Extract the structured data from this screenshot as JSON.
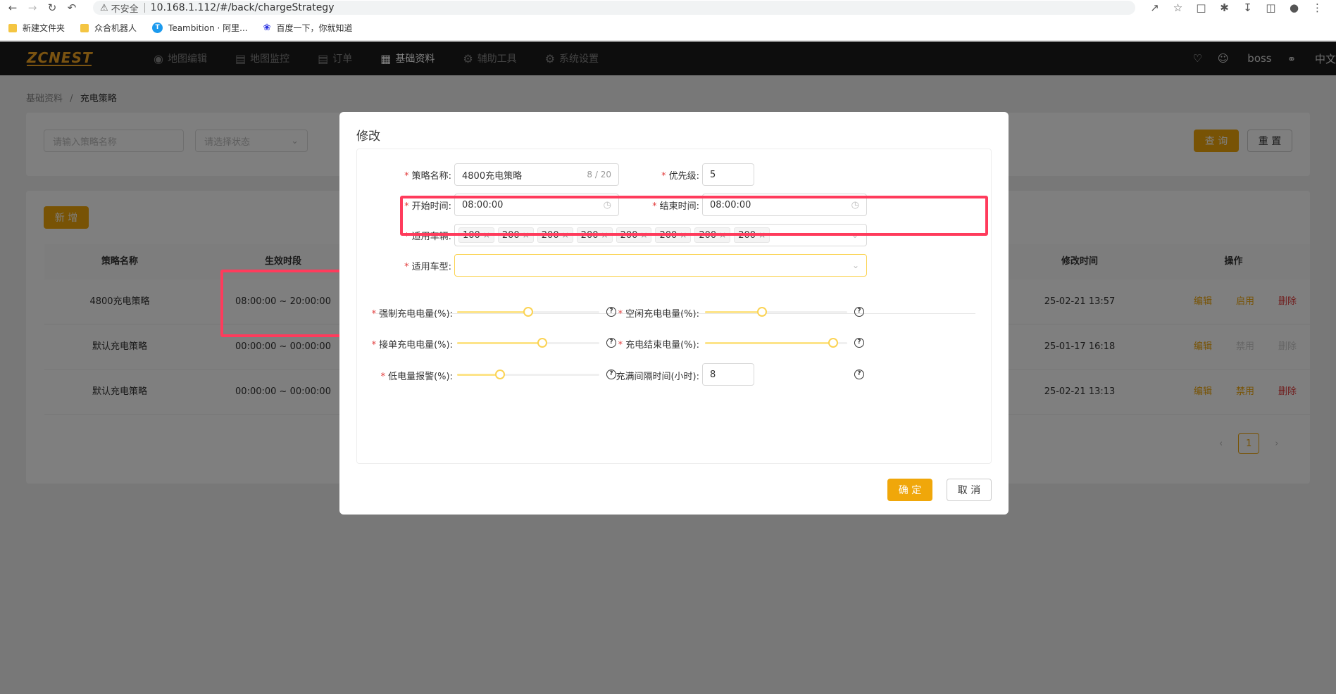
{
  "browser": {
    "insecure_label": "不安全",
    "url": "10.168.1.112/#/back/chargeStrategy",
    "bookmarks": [
      "新建文件夹",
      "众合机器人",
      "Teambition · 阿里...",
      "百度一下，你就知道"
    ]
  },
  "header": {
    "logo": "ZCNEST",
    "menu": [
      "地图编辑",
      "地图监控",
      "订单",
      "基础资料",
      "辅助工具",
      "系统设置"
    ],
    "active_menu": "基础资料",
    "user": "boss",
    "lang": "中文"
  },
  "breadcrumb": {
    "parent": "基础资料",
    "sep": "/",
    "current": "充电策略"
  },
  "search": {
    "name_placeholder": "请输入策略名称",
    "status_placeholder": "请选择状态",
    "query_label": "查 询",
    "reset_label": "重 置"
  },
  "table": {
    "add_label": "新 增",
    "columns": [
      "策略名称",
      "生效时段",
      "修改时间",
      "操作"
    ],
    "rows": [
      {
        "name": "4800充电策略",
        "period": "08:00:00 ~ 20:00:00",
        "modified": "25-02-21 13:57",
        "edit": "编辑",
        "toggle": "启用",
        "delete": "删除"
      },
      {
        "name": "默认充电策略",
        "period": "00:00:00 ~ 00:00:00",
        "modified": "25-01-17 16:18",
        "edit": "编辑",
        "toggle": "禁用",
        "delete": "删除"
      },
      {
        "name": "默认充电策略",
        "period": "00:00:00 ~ 00:00:00",
        "modified": "25-02-21 13:13",
        "edit": "编辑",
        "toggle": "禁用",
        "delete": "删除"
      }
    ],
    "pagination": {
      "current": "1"
    }
  },
  "dialog": {
    "title": "修改",
    "fields": {
      "name_label": "策略名称:",
      "name_value": "4800充电策略",
      "name_count": "8 / 20",
      "priority_label": "优先级:",
      "priority_value": "5",
      "start_label": "开始时间:",
      "start_value": "08:00:00",
      "end_label": "结束时间:",
      "end_value": "08:00:00",
      "vehicles_label": "适用车辆:",
      "vehicle_tags": [
        "100",
        "200",
        "200",
        "200",
        "200",
        "200",
        "200",
        "200"
      ],
      "vtype_label": "适用车型:",
      "force_label": "强制充电电量(%):",
      "idle_label": "空闲充电电量(%):",
      "order_label": "接单充电电量(%):",
      "end_charge_label": "充电结束电量(%):",
      "low_label": "低电量报警(%):",
      "interval_label": "充满间隔时间(小时):",
      "interval_value": "8"
    },
    "sliders": {
      "force": 0.5,
      "idle": 0.4,
      "order": 0.6,
      "end_charge": 0.9,
      "low": 0.3
    },
    "ok_label": "确 定",
    "cancel_label": "取 消"
  }
}
